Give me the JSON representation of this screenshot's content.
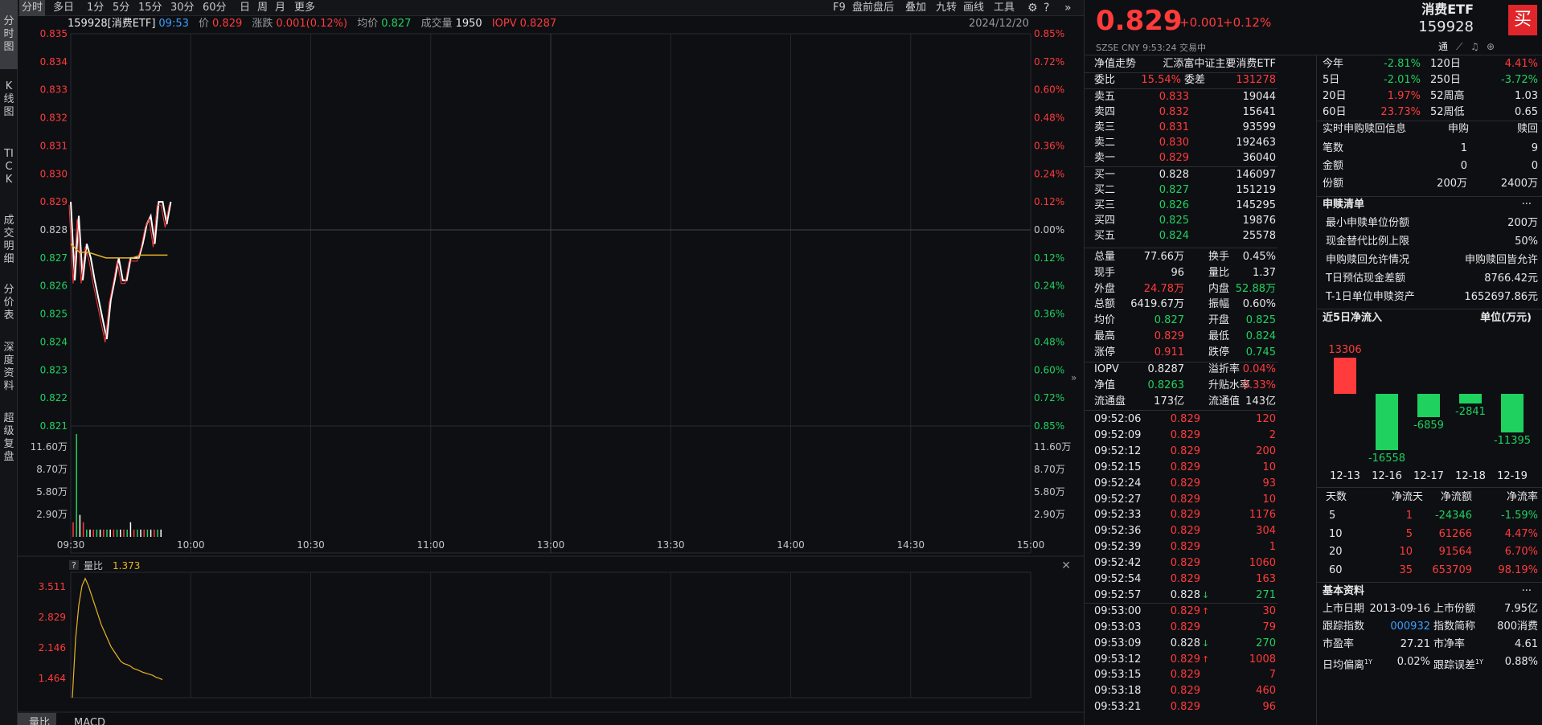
{
  "left_tabs": [
    {
      "label": "分时图"
    },
    {
      "label": "K线图"
    },
    {
      "label": "TICK"
    },
    {
      "label": "成交明细"
    },
    {
      "label": "分价表"
    },
    {
      "label": "深度资料"
    },
    {
      "label": "超级复盘"
    }
  ],
  "toolbar_left": [
    "分时",
    "多日",
    "1分",
    "5分",
    "15分",
    "30分",
    "60分",
    "日",
    "周",
    "月",
    "更多"
  ],
  "toolbar_right": [
    "F9",
    "盘前盘后",
    "叠加",
    "九转",
    "画线",
    "工具"
  ],
  "info": {
    "code": "159928[消费ETF]",
    "time": "09:53",
    "price_label": "价",
    "price": "0.829",
    "chg_label": "涨跌",
    "chg": "0.001(0.12%)",
    "avg_label": "均价",
    "avg": "0.827",
    "vol_label": "成交量",
    "vol": "1950",
    "iopv_label": "IOPV",
    "iopv": "0.8287",
    "date": "2024/12/20"
  },
  "price_axis": [
    "0.835",
    "0.834",
    "0.833",
    "0.832",
    "0.831",
    "0.830",
    "0.829",
    "0.828",
    "0.827",
    "0.826",
    "0.825",
    "0.824",
    "0.823",
    "0.822",
    "0.821"
  ],
  "pct_axis": [
    "0.85%",
    "0.72%",
    "0.60%",
    "0.48%",
    "0.36%",
    "0.24%",
    "0.12%",
    "0.00%",
    "0.12%",
    "0.24%",
    "0.36%",
    "0.48%",
    "0.60%",
    "0.72%",
    "0.85%"
  ],
  "vol_axis": [
    "11.60万",
    "8.70万",
    "5.80万",
    "2.90万"
  ],
  "time_axis": [
    "09:30",
    "10:00",
    "10:30",
    "11:00",
    "13:00",
    "13:30",
    "14:00",
    "14:30",
    "15:00"
  ],
  "price_series": [
    0.829,
    0.8262,
    0.8285,
    0.8262,
    0.8275,
    0.827,
    0.8262,
    0.8255,
    0.8248,
    0.8241,
    0.8255,
    0.8262,
    0.827,
    0.8262,
    0.8262,
    0.827,
    0.827,
    0.827,
    0.8275,
    0.8282,
    0.8285,
    0.8275,
    0.829,
    0.829,
    0.8282,
    0.829
  ],
  "avg_series": [
    0.8275,
    0.8272,
    0.8272,
    0.8271,
    0.827,
    0.827,
    0.827,
    0.827,
    0.8271,
    0.8271,
    0.8271,
    0.8271
  ],
  "volume_bars": [
    2,
    14,
    3,
    2,
    1,
    1,
    1,
    1,
    1,
    1,
    1,
    1,
    1,
    1,
    1,
    1,
    1,
    2,
    1,
    1,
    1,
    1,
    1,
    1,
    1,
    1,
    1
  ],
  "vol_ratio": {
    "label": "量比",
    "value": "1.373",
    "axis": [
      "3.511",
      "2.829",
      "2.146",
      "1.464"
    ],
    "series": [
      1.0,
      2.2,
      2.9,
      3.3,
      3.45,
      3.3,
      3.1,
      2.9,
      2.7,
      2.5,
      2.35,
      2.2,
      2.05,
      1.95,
      1.85,
      1.75,
      1.7,
      1.68,
      1.65,
      1.6,
      1.58,
      1.55,
      1.52,
      1.5,
      1.48,
      1.46,
      1.42,
      1.4,
      1.37
    ]
  },
  "bottom_tabs": [
    "量比",
    "MACD"
  ],
  "quote": {
    "price": "0.829",
    "chg": "+0.001",
    "pct": "+0.12%",
    "name": "消费ETF",
    "code": "159928",
    "market": "SZSE",
    "currency": "CNY",
    "time": "9:53:24",
    "status": "交易中",
    "nav_trend": "净值走势",
    "fund_name": "汇添富中证主要消费ETF",
    "buy": "买",
    "tong": "通"
  },
  "order_ratio": {
    "wb_label": "委比",
    "wb": "15.54%",
    "wc_label": "委差",
    "wc": "131278"
  },
  "asks": [
    {
      "l": "卖五",
      "p": "0.833",
      "v": "19044"
    },
    {
      "l": "卖四",
      "p": "0.832",
      "v": "15641"
    },
    {
      "l": "卖三",
      "p": "0.831",
      "v": "93599"
    },
    {
      "l": "卖二",
      "p": "0.830",
      "v": "192463"
    },
    {
      "l": "卖一",
      "p": "0.829",
      "v": "36040"
    }
  ],
  "bids": [
    {
      "l": "买一",
      "p": "0.828",
      "v": "146097"
    },
    {
      "l": "买二",
      "p": "0.827",
      "v": "151219"
    },
    {
      "l": "买三",
      "p": "0.826",
      "v": "145295"
    },
    {
      "l": "买四",
      "p": "0.825",
      "v": "19876"
    },
    {
      "l": "买五",
      "p": "0.824",
      "v": "25578"
    }
  ],
  "stats": [
    {
      "a": "总量",
      "av": "77.66万",
      "b": "换手",
      "bv": "0.45%"
    },
    {
      "a": "现手",
      "av": "96",
      "b": "量比",
      "bv": "1.37"
    },
    {
      "a": "外盘",
      "av": "24.78万",
      "b": "内盘",
      "bv": "52.88万"
    },
    {
      "a": "总额",
      "av": "6419.67万",
      "b": "振幅",
      "bv": "0.60%"
    },
    {
      "a": "均价",
      "av": "0.827",
      "b": "开盘",
      "bv": "0.825"
    },
    {
      "a": "最高",
      "av": "0.829",
      "b": "最低",
      "bv": "0.824"
    },
    {
      "a": "涨停",
      "av": "0.911",
      "b": "跌停",
      "bv": "0.745"
    }
  ],
  "iopv_stats": [
    {
      "a": "IOPV",
      "av": "0.8287",
      "b": "溢折率",
      "bv": "0.04%"
    },
    {
      "a": "净值",
      "av": "0.8263",
      "b": "升贴水率",
      "bv": "0.33%"
    },
    {
      "a": "流通盘",
      "av": "173亿",
      "b": "流通值",
      "bv": "143亿"
    }
  ],
  "ticks": [
    {
      "t": "09:52:06",
      "p": "0.829",
      "v": "120",
      "d": ""
    },
    {
      "t": "09:52:09",
      "p": "0.829",
      "v": "2",
      "d": ""
    },
    {
      "t": "09:52:12",
      "p": "0.829",
      "v": "200",
      "d": ""
    },
    {
      "t": "09:52:15",
      "p": "0.829",
      "v": "10",
      "d": ""
    },
    {
      "t": "09:52:24",
      "p": "0.829",
      "v": "93",
      "d": ""
    },
    {
      "t": "09:52:27",
      "p": "0.829",
      "v": "10",
      "d": ""
    },
    {
      "t": "09:52:33",
      "p": "0.829",
      "v": "1176",
      "d": ""
    },
    {
      "t": "09:52:36",
      "p": "0.829",
      "v": "304",
      "d": ""
    },
    {
      "t": "09:52:39",
      "p": "0.829",
      "v": "1",
      "d": ""
    },
    {
      "t": "09:52:42",
      "p": "0.829",
      "v": "1060",
      "d": ""
    },
    {
      "t": "09:52:54",
      "p": "0.829",
      "v": "163",
      "d": ""
    },
    {
      "t": "09:52:57",
      "p": "0.828",
      "v": "271",
      "d": "down"
    },
    {
      "t": "09:53:00",
      "p": "0.829",
      "v": "30",
      "d": "up"
    },
    {
      "t": "09:53:03",
      "p": "0.829",
      "v": "79",
      "d": ""
    },
    {
      "t": "09:53:09",
      "p": "0.828",
      "v": "270",
      "d": "down"
    },
    {
      "t": "09:53:12",
      "p": "0.829",
      "v": "1008",
      "d": "up"
    },
    {
      "t": "09:53:15",
      "p": "0.829",
      "v": "7",
      "d": ""
    },
    {
      "t": "09:53:18",
      "p": "0.829",
      "v": "460",
      "d": ""
    },
    {
      "t": "09:53:21",
      "p": "0.829",
      "v": "96",
      "d": ""
    }
  ],
  "perf": [
    {
      "a": "今年",
      "av": "-2.81%",
      "b": "120日",
      "bv": "4.41%"
    },
    {
      "a": "5日",
      "av": "-2.01%",
      "b": "250日",
      "bv": "-3.72%"
    },
    {
      "a": "20日",
      "av": "1.97%",
      "b": "52周高",
      "bv": "1.03"
    },
    {
      "a": "60日",
      "av": "23.73%",
      "b": "52周低",
      "bv": "0.65"
    }
  ],
  "subscribe": {
    "title": "实时申购赎回信息",
    "c1": "申购",
    "c2": "赎回",
    "rows": [
      {
        "l": "笔数",
        "a": "1",
        "b": "9"
      },
      {
        "l": "金额",
        "a": "0",
        "b": "0"
      },
      {
        "l": "份额",
        "a": "200万",
        "b": "2400万"
      }
    ]
  },
  "redeem_list": {
    "title": "申赎清单",
    "more": "···",
    "rows": [
      {
        "l": "最小申赎单位份额",
        "v": "200万"
      },
      {
        "l": "现金替代比例上限",
        "v": "50%"
      },
      {
        "l": "申购赎回允许情况",
        "v": "申购赎回皆允许"
      },
      {
        "l": "T日预估现金差额",
        "v": "8766.42元"
      },
      {
        "l": "T-1日单位申赎资产",
        "v": "1652697.86元"
      }
    ]
  },
  "flow": {
    "title": "近5日净流入",
    "unit": "单位(万元)",
    "bars": [
      {
        "d": "12-13",
        "v": 13306
      },
      {
        "d": "12-16",
        "v": -16558
      },
      {
        "d": "12-17",
        "v": -6859
      },
      {
        "d": "12-18",
        "v": -2841
      },
      {
        "d": "12-19",
        "v": -11395
      }
    ],
    "table_head": [
      "天数",
      "净流天",
      "净流额",
      "净流率"
    ],
    "table": [
      {
        "a": "5",
        "b": "1",
        "c": "-24346",
        "d": "-1.59%"
      },
      {
        "a": "10",
        "b": "5",
        "c": "61266",
        "d": "4.47%"
      },
      {
        "a": "20",
        "b": "10",
        "c": "91564",
        "d": "6.70%"
      },
      {
        "a": "60",
        "b": "35",
        "c": "653709",
        "d": "98.19%"
      }
    ]
  },
  "basic": {
    "title": "基本资料",
    "more": "···",
    "rows": [
      {
        "a": "上市日期",
        "av": "2013-09-16",
        "b": "上市份额",
        "bv": "7.95亿"
      },
      {
        "a": "跟踪指数",
        "av": "000932",
        "b": "指数简称",
        "bv": "800消费"
      },
      {
        "a": "市盈率",
        "av": "27.21",
        "b": "市净率",
        "bv": "4.61"
      },
      {
        "a": "日均偏离",
        "sup": "1Y",
        "av": "0.02%",
        "b": "跟踪误差",
        "sup2": "1Y",
        "bv": "0.88%"
      }
    ]
  },
  "colors": {
    "up": "#ff3b3b",
    "down": "#1fd15e",
    "avg": "#e6b422",
    "price": "#ffffff"
  }
}
